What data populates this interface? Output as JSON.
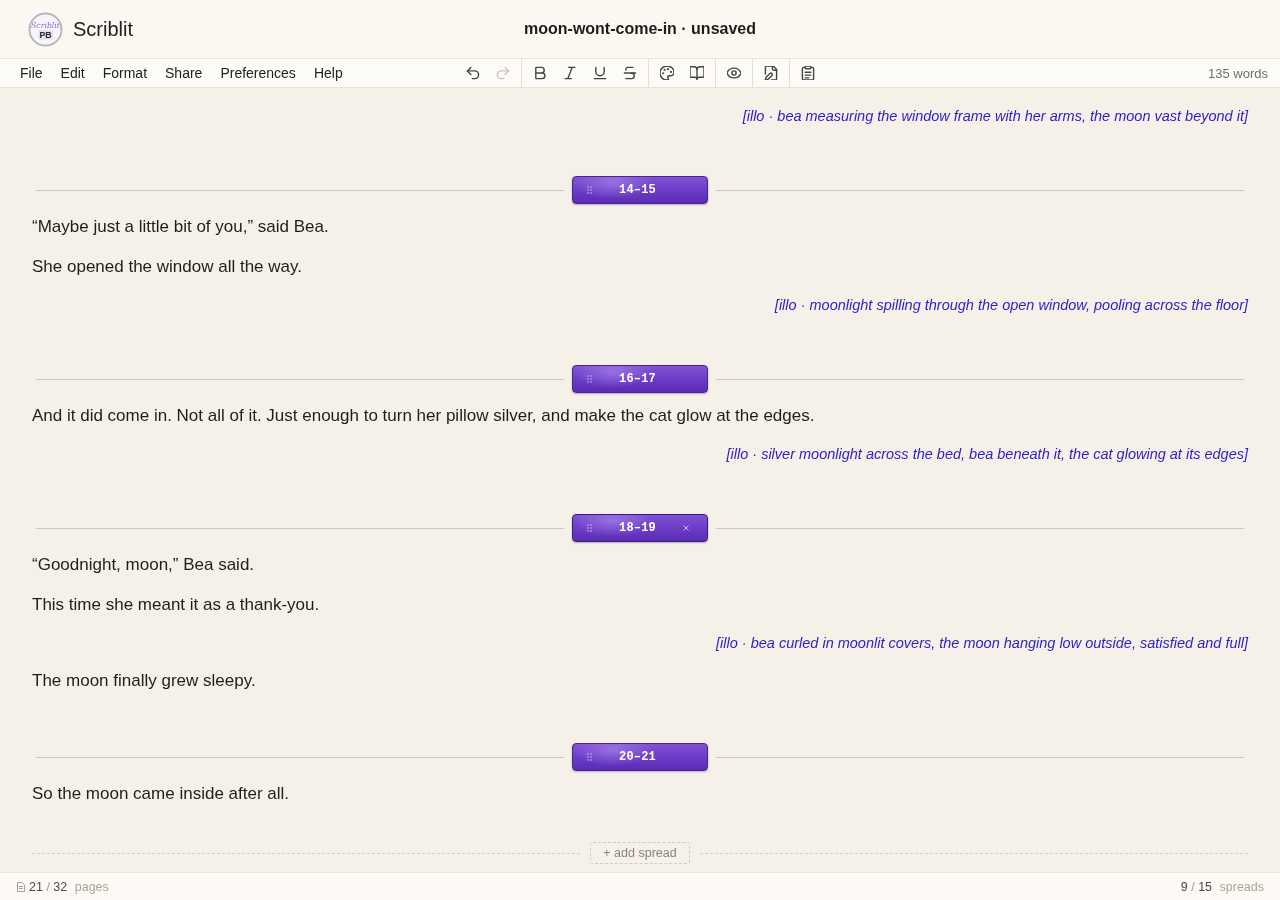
{
  "app": {
    "name": "Scriblit",
    "logo": {
      "script": "Scriblit",
      "tag": "PB"
    }
  },
  "document": {
    "title": "moon-wont-come-in · unsaved"
  },
  "menu": [
    {
      "label": "File"
    },
    {
      "label": "Edit"
    },
    {
      "label": "Format"
    },
    {
      "label": "Share"
    },
    {
      "label": "Preferences"
    },
    {
      "label": "Help"
    }
  ],
  "toolbar": {
    "groups": [
      {
        "tools": [
          {
            "kind": "undo",
            "disabled": false
          },
          {
            "kind": "redo",
            "disabled": true
          }
        ]
      },
      {
        "tools": [
          {
            "kind": "bold",
            "disabled": false
          },
          {
            "kind": "italic",
            "disabled": false
          },
          {
            "kind": "underline",
            "disabled": false
          },
          {
            "kind": "strikethrough",
            "disabled": false
          }
        ]
      },
      {
        "tools": [
          {
            "kind": "palette",
            "disabled": false
          },
          {
            "kind": "book",
            "disabled": false
          }
        ]
      },
      {
        "tools": [
          {
            "kind": "eye",
            "disabled": false
          }
        ]
      },
      {
        "tools": [
          {
            "kind": "file-edit",
            "disabled": false
          }
        ]
      },
      {
        "tools": [
          {
            "kind": "clipboard",
            "disabled": false
          }
        ]
      }
    ]
  },
  "word_count": "135 words",
  "manuscript": [
    {
      "kind": "illustration",
      "text": "[illo · bea measuring the window frame with her arms, the moon vast beyond it]"
    },
    {
      "kind": "spread",
      "label": "14–15",
      "selected": false
    },
    {
      "kind": "paragraph",
      "text": "“Maybe just a little bit of you,” said Bea."
    },
    {
      "kind": "paragraph",
      "text": "She opened the window all the way."
    },
    {
      "kind": "illustration",
      "text": "[illo · moonlight spilling through the open window, pooling across the floor]"
    },
    {
      "kind": "spread",
      "label": "16–17",
      "selected": false
    },
    {
      "kind": "paragraph",
      "text": "And it did come in. Not all of it. Just enough to turn her pillow silver, and make the cat glow at the edges."
    },
    {
      "kind": "illustration",
      "text": "[illo · silver moonlight across the bed, bea beneath it, the cat glowing at its edges]"
    },
    {
      "kind": "spread",
      "label": "18–19",
      "selected": true
    },
    {
      "kind": "paragraph",
      "text": "“Goodnight, moon,” Bea said."
    },
    {
      "kind": "paragraph",
      "text": "This time she meant it as a thank-you."
    },
    {
      "kind": "illustration",
      "text": "[illo · bea curled in moonlit covers, the moon hanging low outside, satisfied and full]"
    },
    {
      "kind": "paragraph",
      "text": "The moon finally grew sleepy."
    },
    {
      "kind": "spread",
      "label": "20–21",
      "selected": false
    },
    {
      "kind": "paragraph",
      "text": "So the moon came inside after all."
    }
  ],
  "add_spread": {
    "label": "+ add spread"
  },
  "status_bar": {
    "pages": {
      "current": "21",
      "separator": "/",
      "total": "32",
      "unit": "pages"
    },
    "spreads": {
      "current": "9",
      "separator": "/",
      "total": "15",
      "unit": "spreads"
    }
  }
}
